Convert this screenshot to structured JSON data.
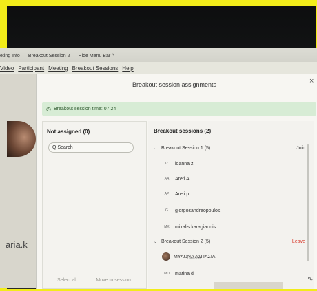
{
  "top_bar": {
    "items": [
      "eting Info",
      "Breakout Session 2",
      "Hide Menu Bar ^"
    ]
  },
  "menu_bar": {
    "items": [
      "Video",
      "Participant",
      "Meeting",
      "Breakout Sessions",
      "Help"
    ]
  },
  "left_participant": {
    "name": "aria.k"
  },
  "dialog": {
    "title": "Breakout session assignments",
    "close": "×",
    "timer": "Breakout session time: 07:24",
    "not_assigned": {
      "title": "Not assigned (0)",
      "search_placeholder": "Search"
    },
    "bottom_actions": [
      "Select all",
      "Move to session"
    ],
    "sessions": {
      "title": "Breakout sessions  (2)",
      "list": [
        {
          "name": "Breakout Session 1 (5)",
          "action": "Join",
          "members": [
            {
              "initials": "IZ",
              "name": "ioanna z"
            },
            {
              "initials": "AA",
              "name": "Areti A."
            },
            {
              "initials": "AP",
              "name": "Areti p"
            },
            {
              "initials": "G",
              "name": "giorgosandreopoulos"
            },
            {
              "initials": "MK",
              "name": "mixalis karagiannis"
            }
          ]
        },
        {
          "name": "Breakout Session 2 (5)",
          "action": "Leave",
          "members": [
            {
              "initials": "",
              "name": "ΜΥΛΩΝΑ ΑΣΠΑΣΙΑ",
              "sub": "Host, me"
            },
            {
              "initials": "MD",
              "name": "matina d"
            }
          ]
        }
      ]
    }
  },
  "colors": {
    "leave": "#d8382a",
    "timer_bg": "#d7ecd5",
    "border_yellow": "#f2ec1a"
  }
}
